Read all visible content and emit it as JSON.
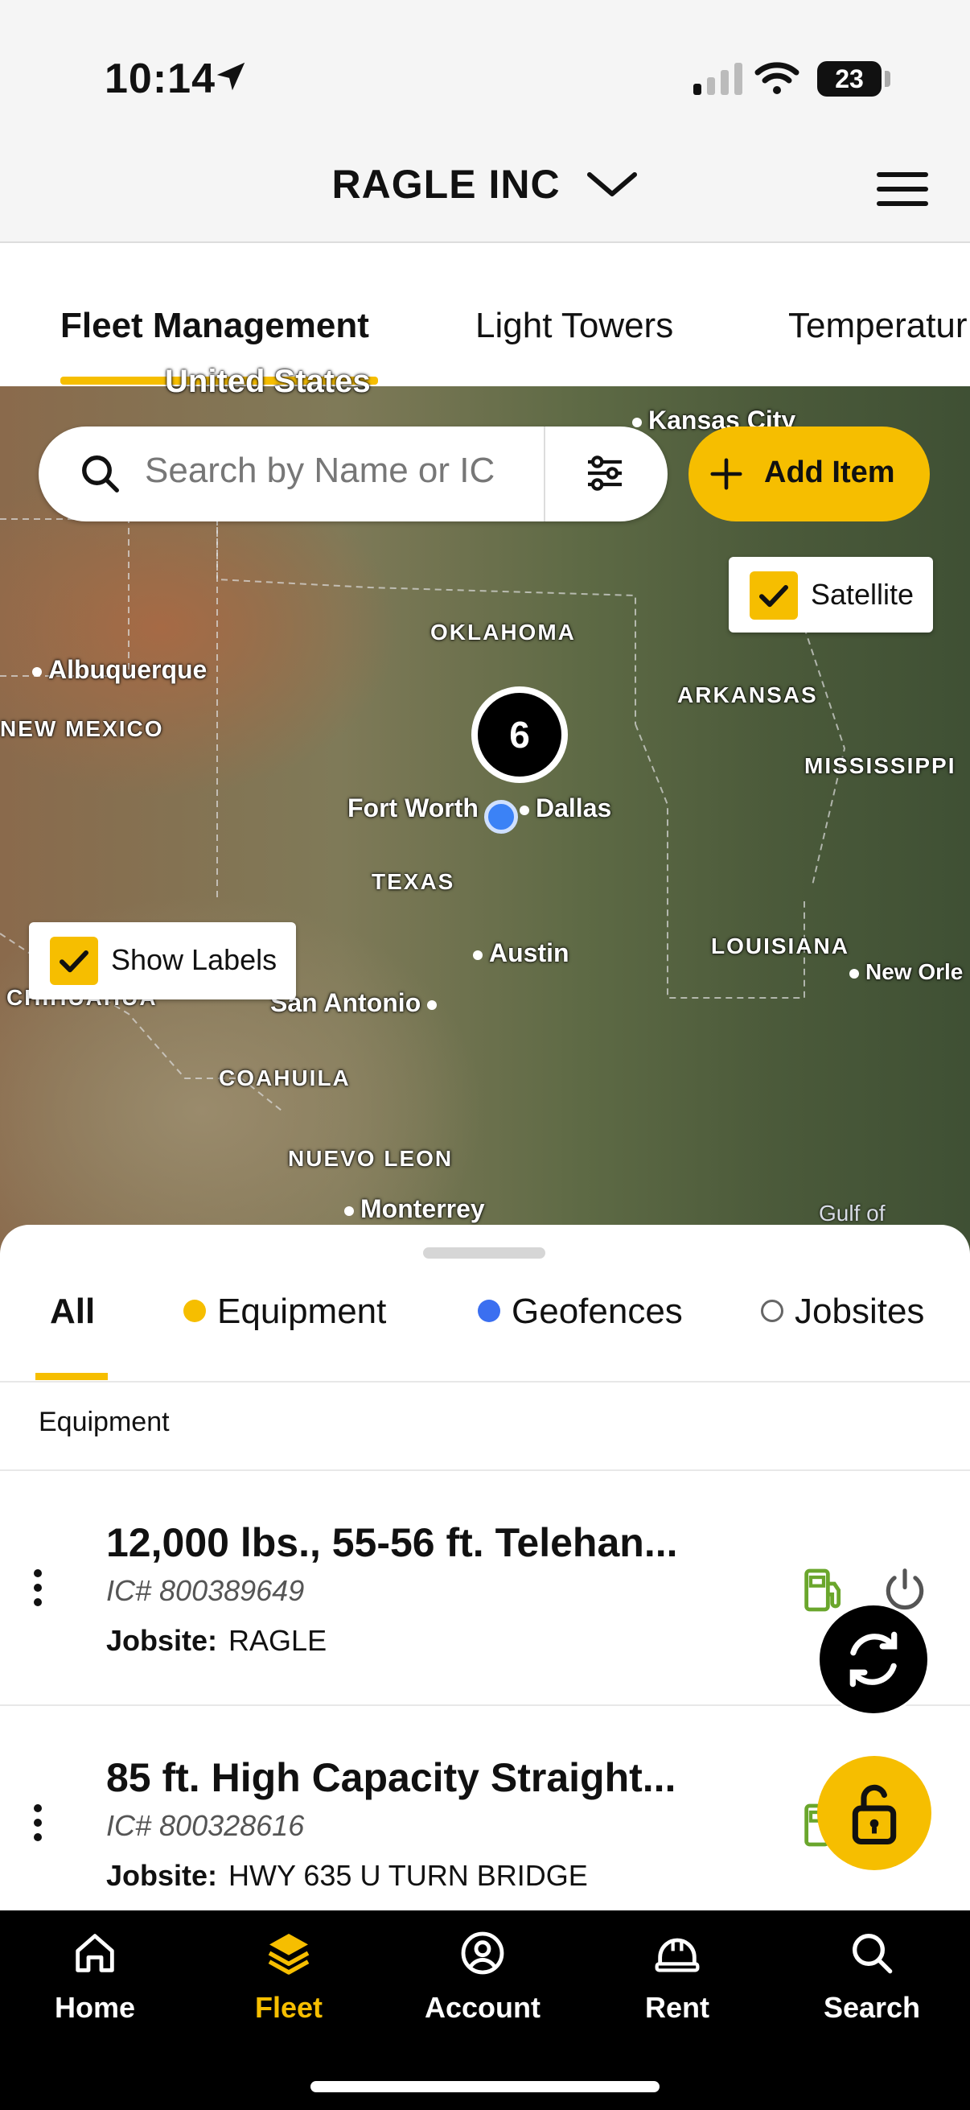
{
  "status_bar": {
    "time": "10:14",
    "battery": "23"
  },
  "header": {
    "company": "RAGLE INC"
  },
  "tabs": [
    {
      "label": "Fleet Management",
      "active": true
    },
    {
      "label": "Light Towers",
      "active": false
    },
    {
      "label": "Temperatur",
      "active": false
    }
  ],
  "map": {
    "search_placeholder": "Search by Name or IC",
    "add_item_label": "Add Item",
    "satellite_label": "Satellite",
    "show_labels_label": "Show Labels",
    "cluster_count": "6",
    "labels": {
      "united_states": "United States",
      "kansas_city": "Kansas City",
      "oklahoma": "OKLAHOMA",
      "albuquerque": "Albuquerque",
      "new_mexico": "NEW MEXICO",
      "arkansas": "ARKANSAS",
      "mississippi": "MISSISSIPPI",
      "fort_worth": "Fort Worth",
      "dallas": "Dallas",
      "texas": "TEXAS",
      "austin": "Austin",
      "louisiana": "LOUISIANA",
      "new_orleans": "New Orle",
      "chihuahua": "CHIHUAHUA",
      "san_antonio": "San Antonio",
      "coahuila": "COAHUILA",
      "nuevo_leon": "NUEVO LEON",
      "monterrey": "Monterrey",
      "gulf_of": "Gulf of"
    }
  },
  "sheet": {
    "filters": [
      {
        "label": "All",
        "active": true
      },
      {
        "label": "Equipment",
        "color": "#f6be00"
      },
      {
        "label": "Geofences",
        "color": "#3b6ff0"
      },
      {
        "label": "Jobsites",
        "color": "hollow"
      }
    ],
    "section_title": "Equipment",
    "jobsite_label": "Jobsite:",
    "items": [
      {
        "title": "12,000 lbs., 55-56 ft. Telehan...",
        "ic": "IC#  800389649",
        "jobsite": "RAGLE"
      },
      {
        "title": "85 ft. High Capacity Straight...",
        "ic": "IC#  800328616",
        "jobsite": "HWY 635 U TURN BRIDGE"
      }
    ]
  },
  "nav": [
    {
      "label": "Home",
      "icon": "home-icon"
    },
    {
      "label": "Fleet",
      "icon": "layers-icon",
      "active": true
    },
    {
      "label": "Account",
      "icon": "account-icon"
    },
    {
      "label": "Rent",
      "icon": "hardhat-icon"
    },
    {
      "label": "Search",
      "icon": "search-icon"
    }
  ],
  "colors": {
    "accent": "#f6be00",
    "geofence": "#3b6ff0",
    "fuel_green": "#6aa62c"
  }
}
